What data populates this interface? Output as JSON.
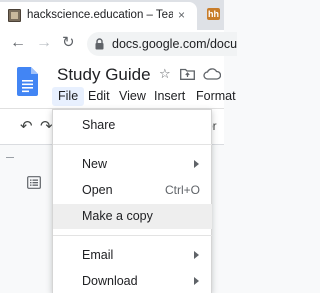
{
  "browser": {
    "tab_title": "hackscience.education – Teaching",
    "tab_close": "×",
    "next_tab_badge": "hh",
    "url": "docs.google.com/docu",
    "back": "←",
    "forward": "→",
    "reload": "↻"
  },
  "docs": {
    "title": "Study Guide",
    "star": "☆",
    "menu": [
      "File",
      "Edit",
      "View",
      "Insert",
      "Format"
    ],
    "active_menu": "File"
  },
  "editing_toolbar": {
    "undo": "↶",
    "redo": "↷",
    "overflow": "or"
  },
  "file_menu": {
    "items": [
      {
        "label": "Share",
        "shortcut": "",
        "submenu": false
      },
      {
        "label": "New",
        "shortcut": "",
        "submenu": true
      },
      {
        "label": "Open",
        "shortcut": "Ctrl+O",
        "submenu": false
      },
      {
        "label": "Make a copy",
        "shortcut": "",
        "submenu": false
      },
      {
        "label": "Email",
        "shortcut": "",
        "submenu": true
      },
      {
        "label": "Download",
        "shortcut": "",
        "submenu": true
      }
    ],
    "hovered_item": "Make a copy"
  },
  "colors": {
    "docs_blue": "#4285f4",
    "menu_active_bg": "#e8f0fe",
    "hover_bg": "#eeeeee"
  }
}
